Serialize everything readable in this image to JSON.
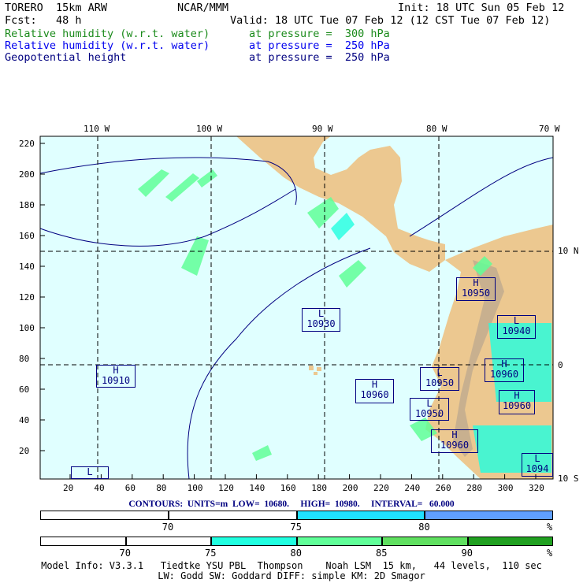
{
  "header": {
    "model": "TORERO  15km ARW",
    "org": "NCAR/MMM",
    "init": "Init: 18 UTC Sun 05 Feb 12",
    "fcst": "Fcst:   48 h",
    "valid": "Valid: 18 UTC Tue 07 Feb 12 (12 CST Tue 07 Feb 12)",
    "fields": [
      {
        "name": "Relative humidity (w.r.t. water)",
        "level": "at pressure =  300 hPa",
        "color": "#1a8a1a"
      },
      {
        "name": "Relative humidity (w.r.t. water)",
        "level": "at pressure =  250 hPa",
        "color": "#0000ee"
      },
      {
        "name": "Geopotential height",
        "level": "at pressure =  250 hPa",
        "color": "#000080"
      }
    ]
  },
  "axes": {
    "lon_labels": [
      "110 W",
      "100 W",
      "90 W",
      "80 W",
      "70 W"
    ],
    "lat_labels": [
      "10 N",
      "0",
      "10 S"
    ],
    "y_ticks": [
      "220",
      "200",
      "180",
      "160",
      "140",
      "120",
      "100",
      "80",
      "60",
      "40",
      "20"
    ],
    "x_ticks": [
      "20",
      "40",
      "60",
      "80",
      "100",
      "120",
      "140",
      "160",
      "180",
      "200",
      "220",
      "240",
      "260",
      "280",
      "300",
      "320"
    ]
  },
  "systems": [
    {
      "type": "H",
      "value": "10910"
    },
    {
      "type": "L",
      "value": ""
    },
    {
      "type": "L",
      "value": "10930"
    },
    {
      "type": "H",
      "value": "10960"
    },
    {
      "type": "H",
      "value": "10950"
    },
    {
      "type": "L",
      "value": "10940"
    },
    {
      "type": "H",
      "value": "10960"
    },
    {
      "type": "L",
      "value": "10950"
    },
    {
      "type": "L",
      "value": "10950"
    },
    {
      "type": "H",
      "value": "10960"
    },
    {
      "type": "H",
      "value": "10960"
    },
    {
      "type": "L",
      "value": "1094"
    }
  ],
  "contours": "CONTOURS:  UNITS=m  LOW=  10680.     HIGH=  10980.     INTERVAL=   60.000",
  "colorbar_250": {
    "labels": [
      "70",
      "75",
      "80",
      "%"
    ],
    "colors": [
      "#ffffff",
      "#ffffff",
      "#20e0ff",
      "#60a0ff"
    ]
  },
  "colorbar_300": {
    "labels": [
      "70",
      "75",
      "80",
      "85",
      "90",
      "%"
    ],
    "colors": [
      "#ffffff",
      "#ffffff",
      "#20ffe0",
      "#60ff98",
      "#60e060",
      "#20a020"
    ]
  },
  "footer": {
    "line1": "Model Info: V3.3.1   Tiedtke YSU PBL  Thompson    Noah LSM  15 km,   44 levels,  110 sec",
    "line2": "LW: Godd SW: Goddard DIFF: simple KM: 2D Smagor"
  }
}
